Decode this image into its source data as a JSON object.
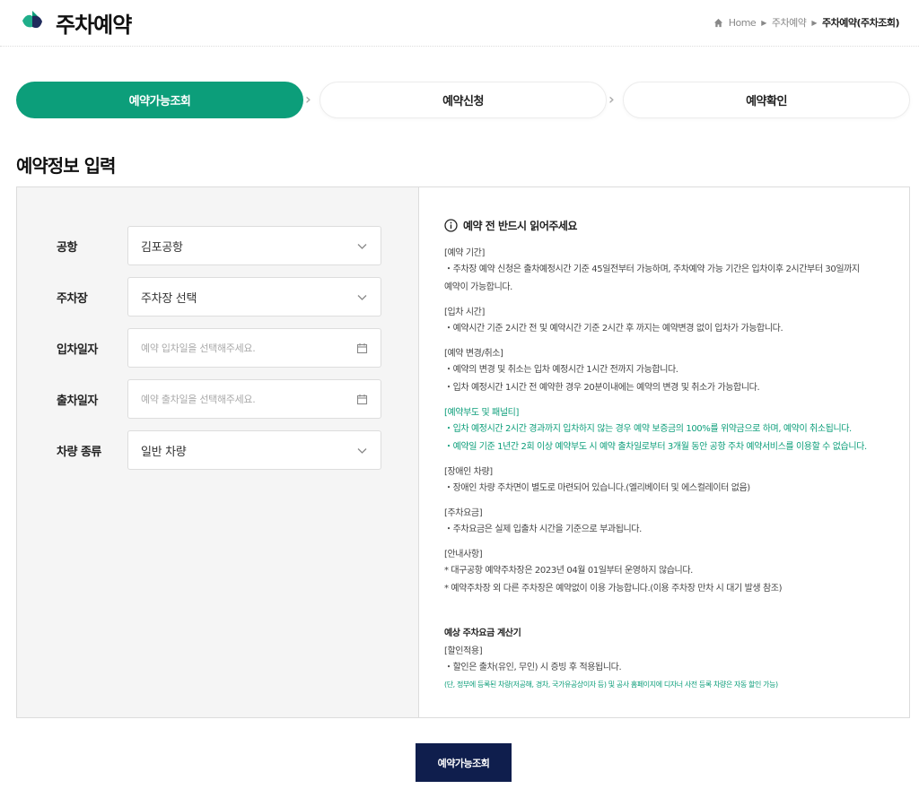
{
  "header": {
    "title": "주차예약",
    "breadcrumb": {
      "home": "Home",
      "section": "주차예약",
      "current": "주차예약(주차조회)"
    }
  },
  "steps": [
    {
      "label": "예약가능조회",
      "active": true
    },
    {
      "label": "예약신청",
      "active": false
    },
    {
      "label": "예약확인",
      "active": false
    }
  ],
  "section_title": "예약정보 입력",
  "form": {
    "airport": {
      "label": "공항",
      "value": "김포공항"
    },
    "parking": {
      "label": "주차장",
      "value": "주차장 선택"
    },
    "entry_date": {
      "label": "입차일자",
      "placeholder": "예약 입차일을 선택해주세요."
    },
    "exit_date": {
      "label": "출차일자",
      "placeholder": "예약 출차일을 선택해주세요."
    },
    "vehicle": {
      "label": "차량 종류",
      "value": "일반 차량"
    }
  },
  "notice": {
    "title": "예약 전 반드시 읽어주세요",
    "blocks": [
      {
        "head": "[예약 기간]",
        "lines": [
          "・주차장 예약 신청은 출차예정시간 기준 45일전부터 가능하며, 주차예약 가능 기간은 입차이후 2시간부터 30일까지",
          "예약이 가능합니다."
        ]
      },
      {
        "head": "[입차 시간]",
        "lines": [
          "・예약시간 기준 2시간 전 및 예약시간 기준 2시간 후 까지는 예약변경 없이 입차가 가능합니다."
        ]
      },
      {
        "head": "[예약 변경/취소]",
        "lines": [
          "・예약의 변경 및 취소는 입차 예정시간 1시간 전까지 가능합니다.",
          "・입차 예정시간 1시간 전 예약한 경우 20분이내에는 예약의 변경 및 취소가 가능합니다."
        ]
      },
      {
        "head": "[예약부도 및 패널티]",
        "lines": [
          "・입차 예정시간 2시간 경과까지 입차하지 않는 경우 예약 보증금의 100%를 위약금으로 하며, 예약이 취소됩니다.",
          "・예약일 기준 1년간 2회 이상 예약부도 시 예약 출차일로부터 3개월 동안 공항 주차 예약서비스를 이용할 수 없습니다."
        ]
      },
      {
        "head": "[장애인 차량]",
        "lines": [
          "・장애인 차량 주차면이 별도로 마련되어 있습니다.(엘리베이터 및 에스컬레이터 없음)"
        ]
      },
      {
        "head": "[주차요금]",
        "lines": [
          "・주차요금은 실제 입출차 시간을 기준으로 부과됩니다."
        ]
      },
      {
        "head": "[안내사항]",
        "lines": [
          "* 대구공항 예약주차장은 2023년 04월 01일부터 운영하지 않습니다.",
          "* 예약주차장 외 다른 주차장은 예약없이 이용 가능합니다.(이용 주차장 만차 시 대기 발생 참조)"
        ]
      }
    ],
    "calc": {
      "title": "예상 주차요금 계산기",
      "head": "[할인적용]",
      "line": "・할인은 출차(유인, 무인) 시 증빙 후 적용됩니다.",
      "note": "(단, 정부에 등록된 차량(저공해, 경차, 국가유공상이자 등) 및 공사 홈페이지에 디자너 사전 등록 차량은 자동 할인 가능)"
    }
  },
  "submit_label": "예약가능조회",
  "colors": {
    "accent": "#0c9e7a",
    "button": "#0f1e4d"
  }
}
